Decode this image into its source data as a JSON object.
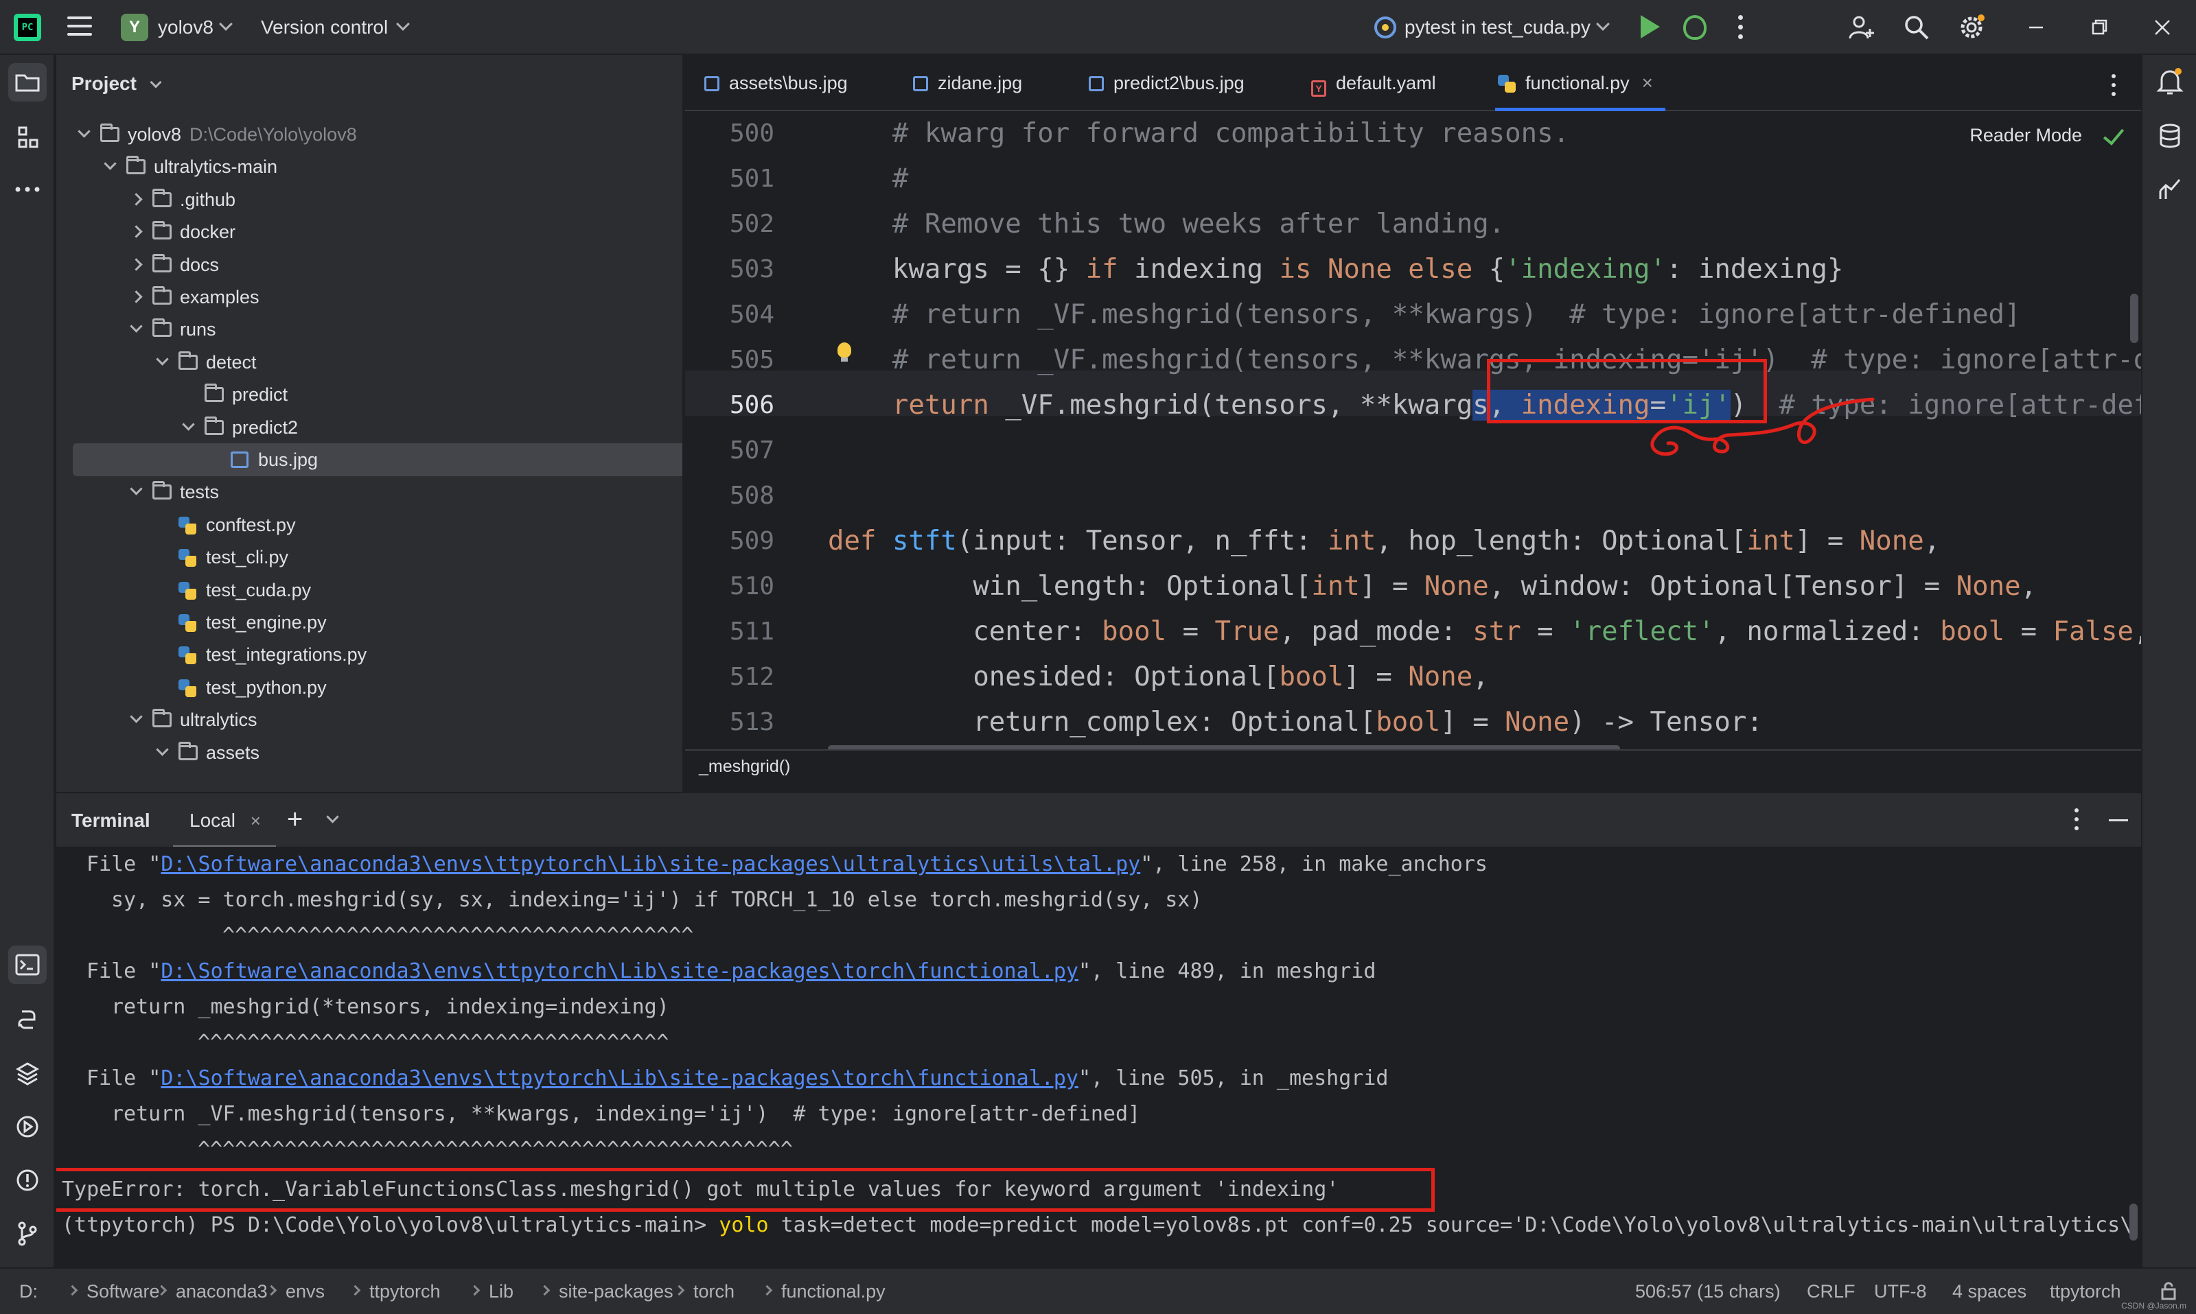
{
  "titlebar": {
    "project_badge": "Y",
    "project_name": "yolov8",
    "vcs": "Version control",
    "run_config": "pytest in test_cuda.py"
  },
  "project_panel": {
    "title": "Project",
    "tree": [
      {
        "label": "yolov8",
        "path": "D:\\Code\\Yolo\\yolov8",
        "type": "folder",
        "depth": 0,
        "state": "open"
      },
      {
        "label": "ultralytics-main",
        "type": "folder",
        "depth": 1,
        "state": "open"
      },
      {
        "label": ".github",
        "type": "folder",
        "depth": 2,
        "state": "closed"
      },
      {
        "label": "docker",
        "type": "folder",
        "depth": 2,
        "state": "closed"
      },
      {
        "label": "docs",
        "type": "folder",
        "depth": 2,
        "state": "closed"
      },
      {
        "label": "examples",
        "type": "folder",
        "depth": 2,
        "state": "closed"
      },
      {
        "label": "runs",
        "type": "folder",
        "depth": 2,
        "state": "open"
      },
      {
        "label": "detect",
        "type": "folder",
        "depth": 3,
        "state": "open"
      },
      {
        "label": "predict",
        "type": "folder",
        "depth": 4,
        "state": "none"
      },
      {
        "label": "predict2",
        "type": "folder",
        "depth": 4,
        "state": "open"
      },
      {
        "label": "bus.jpg",
        "type": "image",
        "depth": 5,
        "state": "none",
        "selected": true
      },
      {
        "label": "tests",
        "type": "folder",
        "depth": 2,
        "state": "open"
      },
      {
        "label": "conftest.py",
        "type": "python",
        "depth": 3,
        "state": "none"
      },
      {
        "label": "test_cli.py",
        "type": "python",
        "depth": 3,
        "state": "none"
      },
      {
        "label": "test_cuda.py",
        "type": "python",
        "depth": 3,
        "state": "none"
      },
      {
        "label": "test_engine.py",
        "type": "python",
        "depth": 3,
        "state": "none"
      },
      {
        "label": "test_integrations.py",
        "type": "python",
        "depth": 3,
        "state": "none"
      },
      {
        "label": "test_python.py",
        "type": "python",
        "depth": 3,
        "state": "none"
      },
      {
        "label": "ultralytics",
        "type": "folder",
        "depth": 2,
        "state": "open"
      },
      {
        "label": "assets",
        "type": "folder",
        "depth": 3,
        "state": "open"
      }
    ]
  },
  "editor": {
    "tabs": [
      {
        "label": "assets\\bus.jpg",
        "icon": "image-icon"
      },
      {
        "label": "zidane.jpg",
        "icon": "image-icon"
      },
      {
        "label": "predict2\\bus.jpg",
        "icon": "image-icon"
      },
      {
        "label": "default.yaml",
        "icon": "yaml-icon"
      },
      {
        "label": "functional.py",
        "icon": "python-icon",
        "active": true
      }
    ],
    "reader_mode": "Reader Mode",
    "breadcrumb": "_meshgrid()",
    "line_numbers": [
      "500",
      "501",
      "502",
      "503",
      "504",
      "505",
      "506",
      "507",
      "508",
      "509",
      "510",
      "511",
      "512",
      "513"
    ],
    "current_line": "506"
  },
  "terminal": {
    "title": "Terminal",
    "tab": "Local",
    "lines": {
      "l1_pre": "File \"",
      "l1_link": "D:\\Software\\anaconda3\\envs\\ttpytorch\\Lib\\site-packages\\ultralytics\\utils\\tal.py",
      "l1_post": "\", line 258, in make_anchors",
      "l2": "sy, sx = torch.meshgrid(sy, sx, indexing='ij') if TORCH_1_10 else torch.meshgrid(sy, sx)",
      "l3": "^^^^^^^^^^^^^^^^^^^^^^^^^^^^^^^^^^^^^^",
      "l4_pre": "File \"",
      "l4_link": "D:\\Software\\anaconda3\\envs\\ttpytorch\\Lib\\site-packages\\torch\\functional.py",
      "l4_post": "\", line 489, in meshgrid",
      "l5": "return _meshgrid(*tensors, indexing=indexing)",
      "l6": "^^^^^^^^^^^^^^^^^^^^^^^^^^^^^^^^^^^^^^",
      "l7_pre": "File \"",
      "l7_link": "D:\\Software\\anaconda3\\envs\\ttpytorch\\Lib\\site-packages\\torch\\functional.py",
      "l7_post": "\", line 505, in _meshgrid",
      "l8": "return _VF.meshgrid(tensors, **kwargs, indexing='ij')  # type: ignore[attr-defined]",
      "l9": "^^^^^^^^^^^^^^^^^^^^^^^^^^^^^^^^^^^^^^^^^^^^^^^^",
      "l10": "TypeError: torch._VariableFunctionsClass.meshgrid() got multiple values for keyword argument 'indexing'",
      "l11_prompt": "(ttpytorch) PS D:\\Code\\Yolo\\yolov8\\ultralytics-main> ",
      "l11_cmd": "yolo",
      "l11_args": " task=detect mode=predict model=yolov8s.pt conf=0.25 source='D:\\Code\\Yolo\\yolov8\\ultralytics-main\\ultralytics\\"
    }
  },
  "statusbar": {
    "path": [
      "D:",
      "Software",
      "anaconda3",
      "envs",
      "ttpytorch",
      "Lib",
      "site-packages",
      "torch",
      "functional.py"
    ],
    "position": "506:57 (15 chars)",
    "line_sep": "CRLF",
    "encoding": "UTF-8",
    "indent": "4 spaces",
    "interpreter": "ttpytorch"
  },
  "watermark": "CSDN @Jason.m",
  "colors": {
    "background": "#1e1f22",
    "panel": "#2b2d30",
    "annotation_red": "#e0211b",
    "accent": "#3574f0"
  }
}
